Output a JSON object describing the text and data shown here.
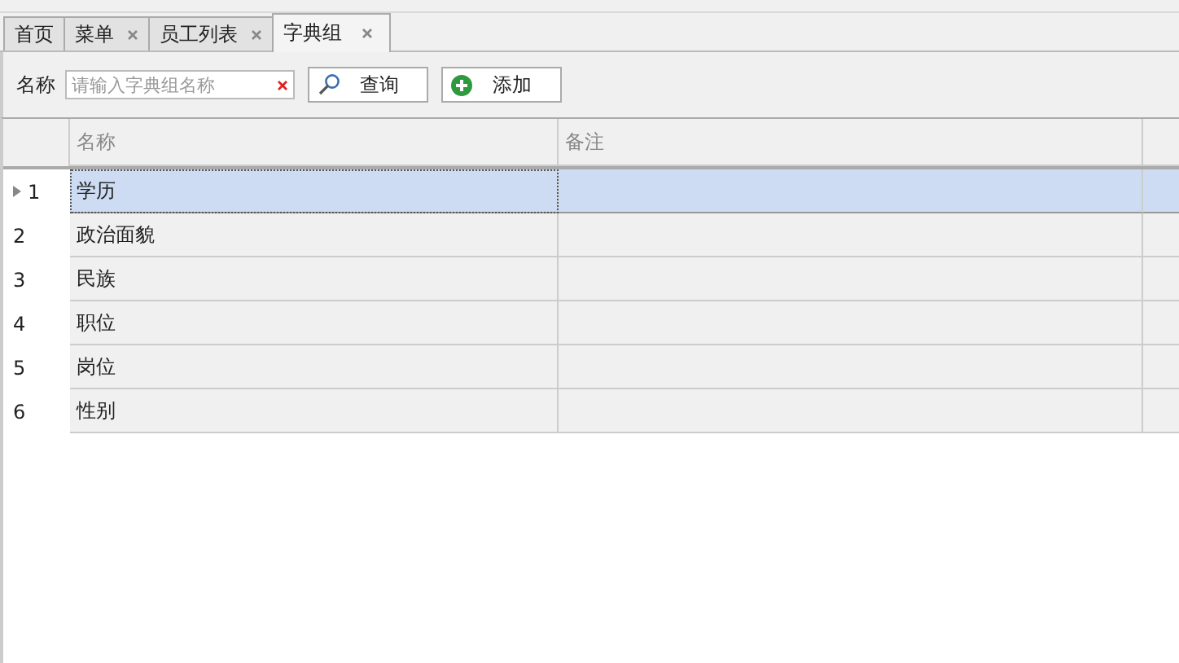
{
  "tabs": [
    {
      "label": "首页",
      "closable": false,
      "selected": false
    },
    {
      "label": "菜单",
      "closable": true,
      "selected": false
    },
    {
      "label": "员工列表",
      "closable": true,
      "selected": false
    },
    {
      "label": "字典组",
      "closable": true,
      "selected": true
    }
  ],
  "search": {
    "label": "名称",
    "placeholder": "请输入字典组名称"
  },
  "buttons": [
    {
      "kind": "search",
      "label": "查询"
    },
    {
      "kind": "add",
      "label": "添加"
    }
  ],
  "table": {
    "columns": [
      "名称",
      "备注"
    ],
    "rows": [
      {
        "number": "1",
        "name": "学历",
        "selected": true
      },
      {
        "number": "2",
        "name": "政治面貌",
        "selected": false
      },
      {
        "number": "3",
        "name": "民族",
        "selected": false
      },
      {
        "number": "4",
        "name": "职位",
        "selected": false
      },
      {
        "number": "5",
        "name": "岗位",
        "selected": false
      },
      {
        "number": "6",
        "name": "性别",
        "selected": false
      }
    ]
  }
}
